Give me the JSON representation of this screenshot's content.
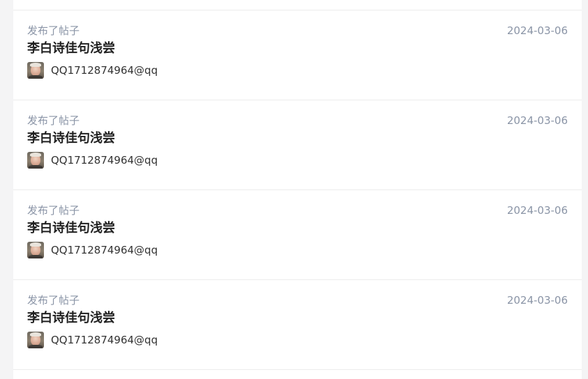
{
  "posts": [
    {
      "action_text": "发布了帖子",
      "date": "2024-03-06",
      "title": "李白诗佳句浅尝",
      "author": "QQ1712874964@qq",
      "avatar_icon": "user-avatar"
    },
    {
      "action_text": "发布了帖子",
      "date": "2024-03-06",
      "title": "李白诗佳句浅尝",
      "author": "QQ1712874964@qq",
      "avatar_icon": "user-avatar"
    },
    {
      "action_text": "发布了帖子",
      "date": "2024-03-06",
      "title": "李白诗佳句浅尝",
      "author": "QQ1712874964@qq",
      "avatar_icon": "user-avatar"
    },
    {
      "action_text": "发布了帖子",
      "date": "2024-03-06",
      "title": "李白诗佳句浅尝",
      "author": "QQ1712874964@qq",
      "avatar_icon": "user-avatar"
    }
  ],
  "colors": {
    "page_background": "#f4f4f5",
    "card_background": "#ffffff",
    "meta_text": "#8a94a6",
    "title_text": "#1f1f1f",
    "divider": "#ececec"
  }
}
